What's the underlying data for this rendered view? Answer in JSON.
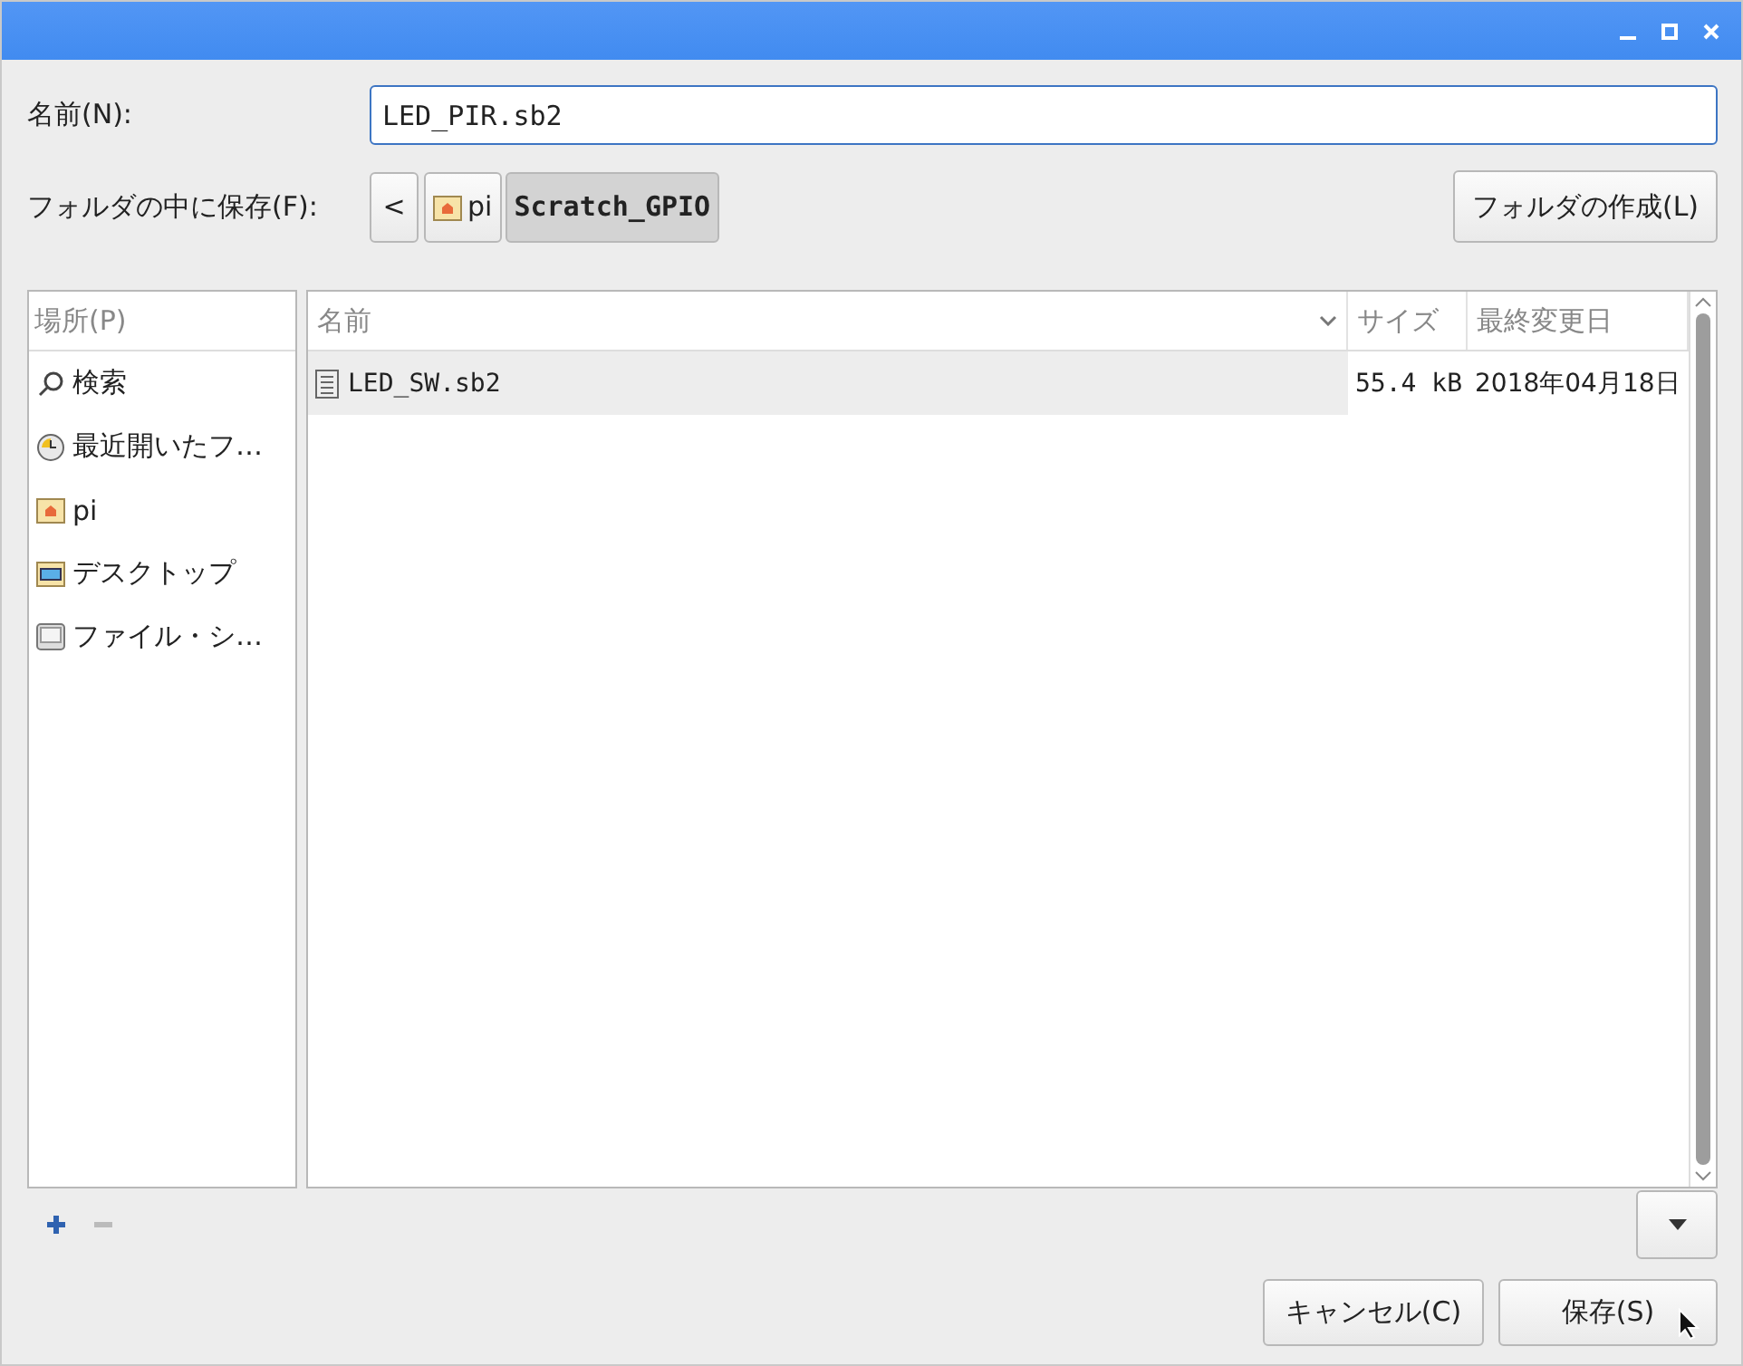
{
  "name_row": {
    "label": "名前(N):",
    "value": "LED_PIR.sb2"
  },
  "folder_row": {
    "label": "フォルダの中に保存(F):",
    "back": "<",
    "path": [
      {
        "label": "pi",
        "kind": "home",
        "selected": false
      },
      {
        "label": "Scratch_GPIO",
        "kind": "plain",
        "selected": true
      }
    ],
    "create_button": "フォルダの作成(L)"
  },
  "places": {
    "header": "場所(P)",
    "items": [
      {
        "label": "検索",
        "kind": "search"
      },
      {
        "label": "最近開いたフ…",
        "kind": "recent"
      },
      {
        "label": "pi",
        "kind": "home"
      },
      {
        "label": "デスクトップ",
        "kind": "desktop"
      },
      {
        "label": "ファイル・シ…",
        "kind": "drive"
      }
    ]
  },
  "files": {
    "columns": [
      {
        "label": "名前",
        "sorted": true
      },
      {
        "label": "サイズ",
        "sorted": false
      },
      {
        "label": "最終変更日",
        "sorted": false
      }
    ],
    "rows": [
      {
        "name": "LED_SW.sb2",
        "size": "55.4 kB",
        "modified": "2018年04月18日"
      }
    ]
  },
  "buttons": [
    {
      "label": "キャンセル(C)",
      "kind": "cancel"
    },
    {
      "label": "保存(S)",
      "kind": "save"
    }
  ]
}
